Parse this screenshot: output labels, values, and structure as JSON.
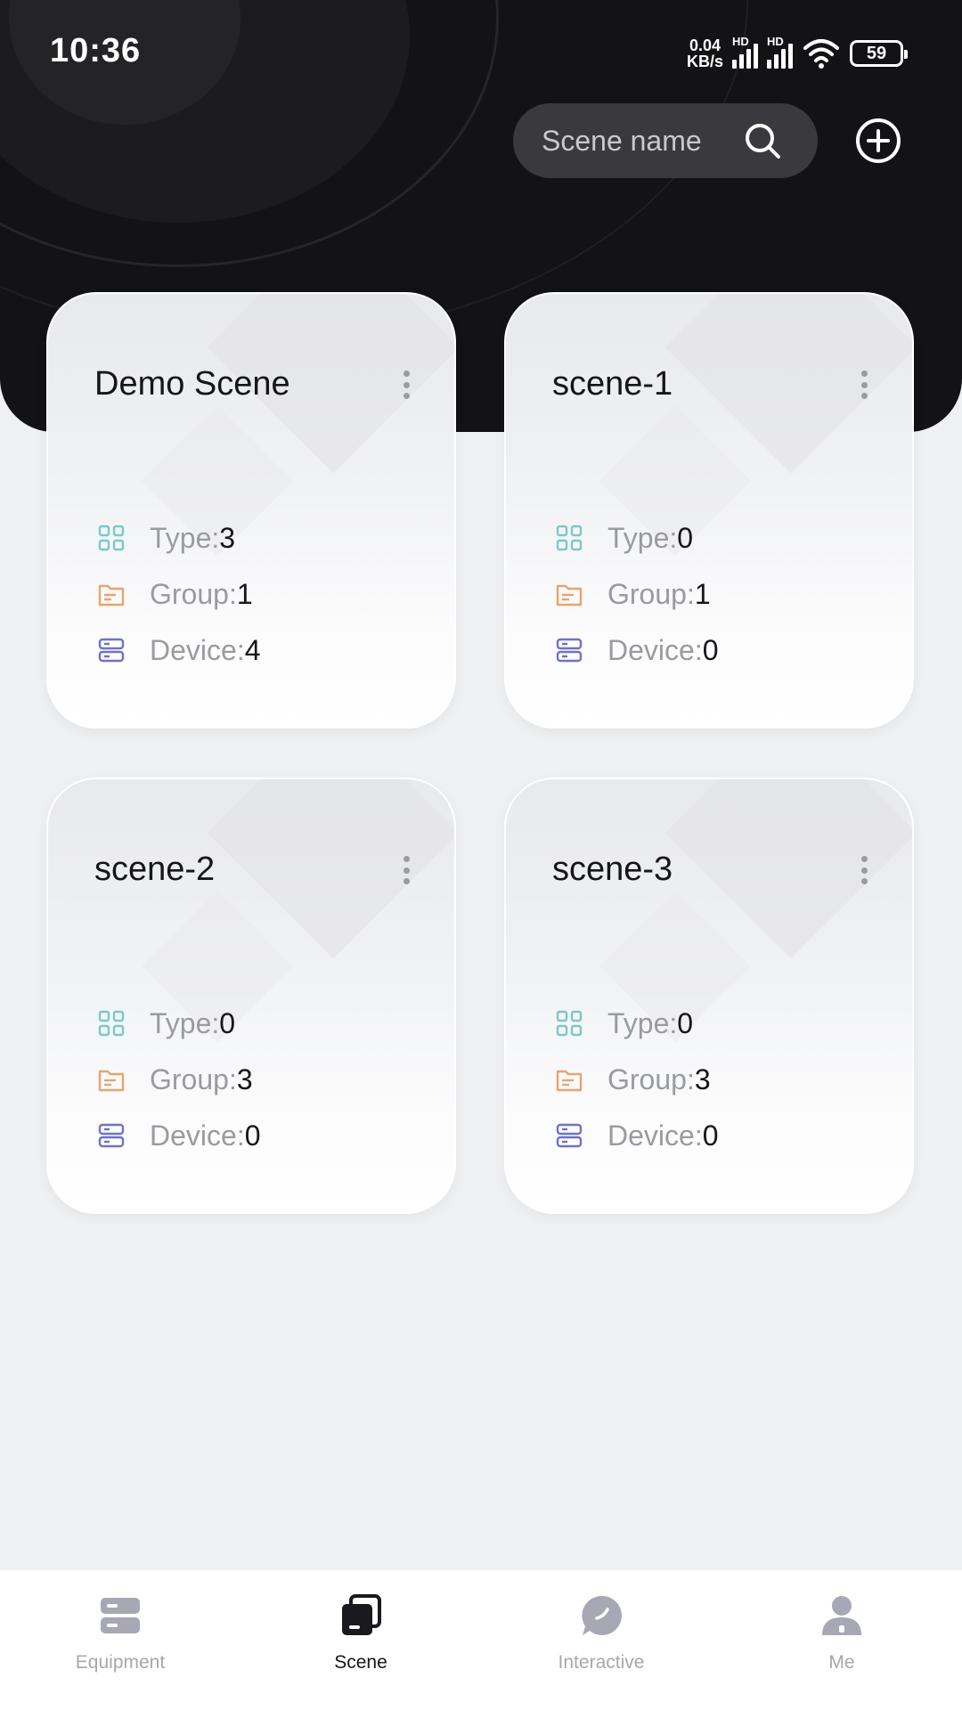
{
  "status_bar": {
    "time": "10:36",
    "net_speed_value": "0.04",
    "net_speed_unit": "KB/s",
    "hd_label": "HD",
    "battery": "59"
  },
  "search": {
    "placeholder": "Scene name"
  },
  "cards": [
    {
      "title": "Demo Scene",
      "type_label": "Type:",
      "type": "3",
      "group_label": "Group:",
      "group": "1",
      "device_label": "Device:",
      "device": "4"
    },
    {
      "title": "scene-1",
      "type_label": "Type:",
      "type": "0",
      "group_label": "Group:",
      "group": "1",
      "device_label": "Device:",
      "device": "0"
    },
    {
      "title": "scene-2",
      "type_label": "Type:",
      "type": "0",
      "group_label": "Group:",
      "group": "3",
      "device_label": "Device:",
      "device": "0"
    },
    {
      "title": "scene-3",
      "type_label": "Type:",
      "type": "0",
      "group_label": "Group:",
      "group": "3",
      "device_label": "Device:",
      "device": "0"
    }
  ],
  "nav": {
    "items": [
      {
        "label": "Equipment",
        "icon": "equipment-icon"
      },
      {
        "label": "Scene",
        "icon": "scene-icon",
        "active": true
      },
      {
        "label": "Interactive",
        "icon": "chat-icon"
      },
      {
        "label": "Me",
        "icon": "person-icon"
      }
    ]
  },
  "colors": {
    "header_bg": "#131315",
    "type_icon": "#7dc8c8",
    "group_icon": "#e8a46e",
    "device_icon": "#6f73c2"
  }
}
